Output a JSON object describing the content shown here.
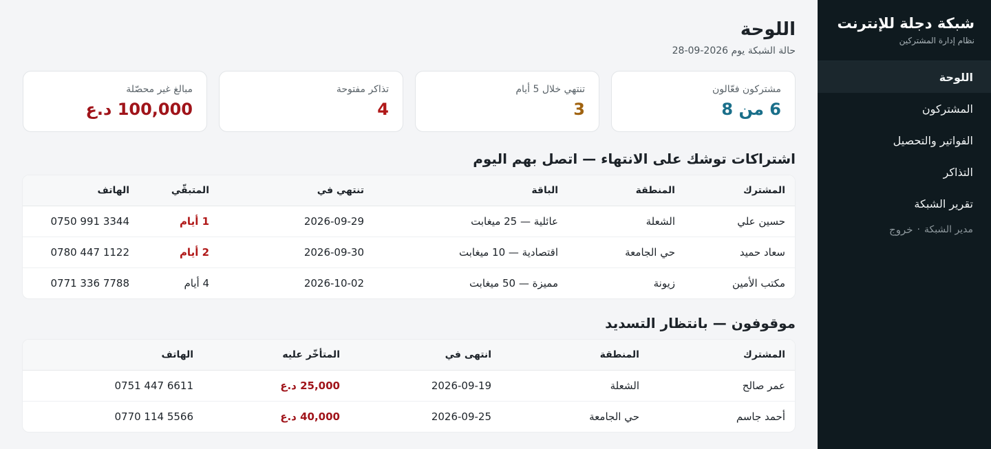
{
  "brand": {
    "title": "شبكة دجلة للإنترنت",
    "subtitle": "نظام إدارة المشتركين"
  },
  "nav": {
    "items": [
      {
        "label": "اللوحة",
        "active": true
      },
      {
        "label": "المشتركون"
      },
      {
        "label": "الفواتير والتحصيل"
      },
      {
        "label": "التذاكر"
      },
      {
        "label": "تقرير الشبكة"
      }
    ],
    "user": "مدير الشبكة",
    "separator": "·",
    "logout": "خروج"
  },
  "header": {
    "title": "اللوحة",
    "subtitle": "حالة الشبكة يوم 2026-09-28"
  },
  "cards": [
    {
      "label": "مشتركون فعّالون",
      "value": "6 من 8",
      "color": "#1a6f8a"
    },
    {
      "label": "تنتهي خلال 5 أيام",
      "value": "3",
      "color": "#a06310"
    },
    {
      "label": "تذاكر مفتوحة",
      "value": "4",
      "color": "#b01818"
    },
    {
      "label": "مبالغ غير محصّلة",
      "value": "100,000 د.ع",
      "color": "#a0141a"
    }
  ],
  "expiring": {
    "title": "اشتراكات توشك على الانتهاء — اتصل بهم اليوم",
    "columns": [
      "المشترك",
      "المنطقة",
      "الباقة",
      "تنتهي في",
      "المتبقّي",
      "الهاتف"
    ],
    "rows": [
      {
        "name": "حسين علي",
        "area": "الشعلة",
        "plan": "عائلية — 25 ميغابت",
        "ends": "2026-09-29",
        "remaining": "1 أيام",
        "urgent": true,
        "phone": "0750 991 3344"
      },
      {
        "name": "سعاد حميد",
        "area": "حي الجامعة",
        "plan": "اقتصادية — 10 ميغابت",
        "ends": "2026-09-30",
        "remaining": "2 أيام",
        "urgent": true,
        "phone": "0780 447 1122"
      },
      {
        "name": "مكتب الأمين",
        "area": "زيونة",
        "plan": "مميزة — 50 ميغابت",
        "ends": "2026-10-02",
        "remaining": "4 أيام",
        "urgent": false,
        "phone": "0771 336 7788"
      }
    ]
  },
  "suspended": {
    "title": "موقوفون — بانتظار التسديد",
    "columns": [
      "المشترك",
      "المنطقة",
      "انتهى في",
      "المتأخّر عليه",
      "الهاتف"
    ],
    "rows": [
      {
        "name": "عمر صالح",
        "area": "الشعلة",
        "ended": "2026-09-19",
        "due": "25,000 د.ع",
        "phone": "0751 447 6611"
      },
      {
        "name": "أحمد جاسم",
        "area": "حي الجامعة",
        "ended": "2026-09-25",
        "due": "40,000 د.ع",
        "phone": "0770 114 5566"
      }
    ]
  }
}
